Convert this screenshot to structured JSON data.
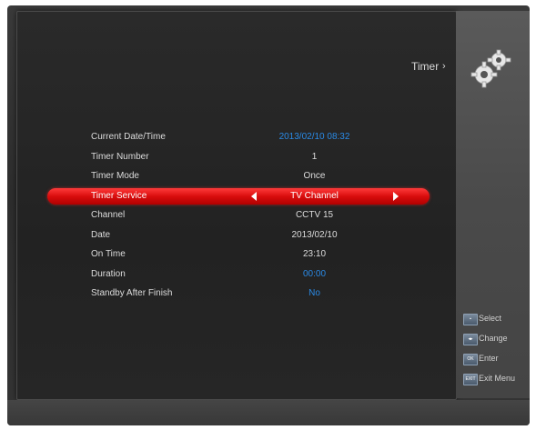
{
  "header": {
    "title": "Timer"
  },
  "rows": [
    {
      "label": "Current Date/Time",
      "value": "2013/02/10 08:32"
    },
    {
      "label": "Timer Number",
      "value": "1"
    },
    {
      "label": "Timer Mode",
      "value": "Once"
    },
    {
      "label": "Timer Service",
      "value": "TV Channel"
    },
    {
      "label": "Channel",
      "value": "CCTV 15"
    },
    {
      "label": "Date",
      "value": "2013/02/10"
    },
    {
      "label": "On Time",
      "value": "23:10"
    },
    {
      "label": "Duration",
      "value": "00:00"
    },
    {
      "label": "Standby After Finish",
      "value": "No"
    }
  ],
  "legend": [
    {
      "key": "▪",
      "label": "Select"
    },
    {
      "key": "◂▸",
      "label": "Change"
    },
    {
      "key": "OK",
      "label": "Enter"
    },
    {
      "key": "EXIT",
      "label": "Exit Menu"
    }
  ],
  "colors": {
    "highlight": "#d90d0d",
    "accent_value": "#2a8ae6",
    "text": "#dcdcdc"
  },
  "icons": {
    "header": "gears-icon"
  }
}
